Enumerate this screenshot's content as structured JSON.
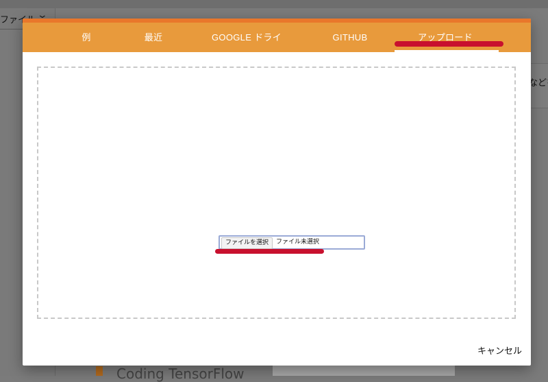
{
  "background": {
    "file_menu_label": "ファイル",
    "card_text": "などを",
    "bottom_text": "Coding TensorFlow"
  },
  "dialog": {
    "tabs": [
      {
        "label": "例"
      },
      {
        "label": "最近"
      },
      {
        "label": "GOOGLE ドライブ"
      },
      {
        "label": "GITHUB"
      },
      {
        "label": "アップロード",
        "selected": true
      }
    ],
    "upload": {
      "choose_button_label": "ファイルを選択",
      "no_file_text": "ファイル未選択"
    },
    "cancel_label": "キャンセル"
  },
  "colors": {
    "tabbar": "#e89a3c",
    "tabbar_top": "#e9772b",
    "annotation": "#c8102e",
    "dropzone_border": "#c8c8c8"
  }
}
